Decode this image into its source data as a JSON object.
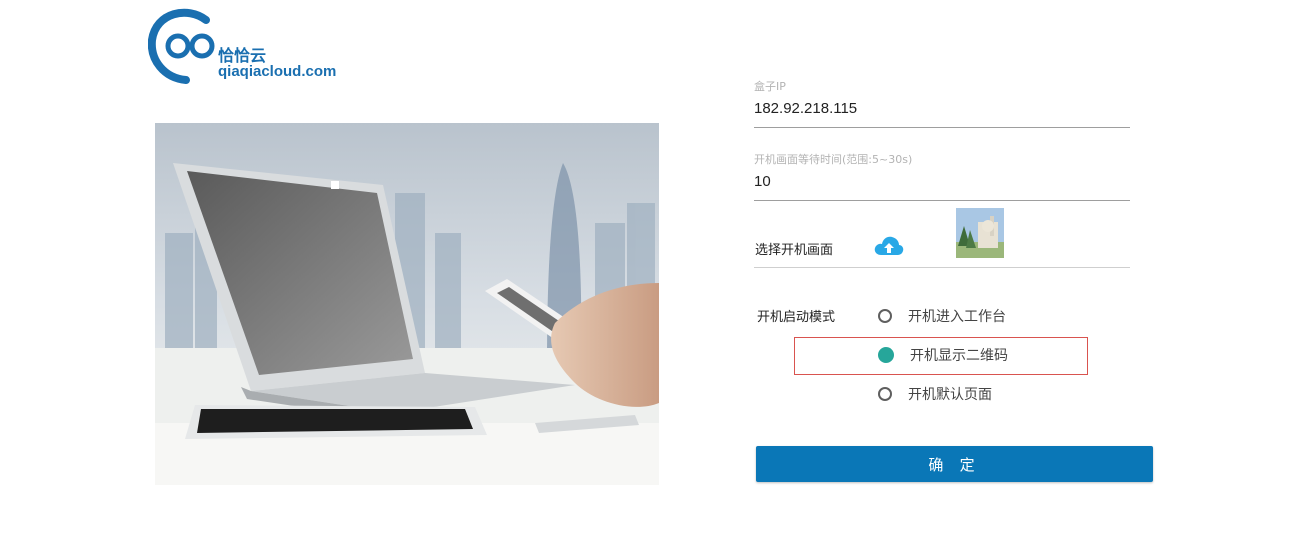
{
  "logo": {
    "name_cn": "恰恰云",
    "domain": "qiaqiacloud.com",
    "brand_color": "#1a6fb0"
  },
  "form": {
    "box_ip": {
      "label": "盒子IP",
      "value": "182.92.218.115"
    },
    "wait_time": {
      "label": "开机画面等待时间(范围:5~30s)",
      "value": "10"
    },
    "boot_image": {
      "label": "选择开机画面",
      "upload_icon": "cloud-upload-icon"
    },
    "boot_mode": {
      "label": "开机启动模式",
      "options": [
        {
          "label": "开机进入工作台",
          "checked": false
        },
        {
          "label": "开机显示二维码",
          "checked": true
        },
        {
          "label": "开机默认页面",
          "checked": false
        }
      ]
    },
    "confirm_label": "确 定"
  },
  "colors": {
    "accent": "#0a77b7",
    "radio_checked": "#26a69a",
    "highlight": "#d9534f"
  }
}
